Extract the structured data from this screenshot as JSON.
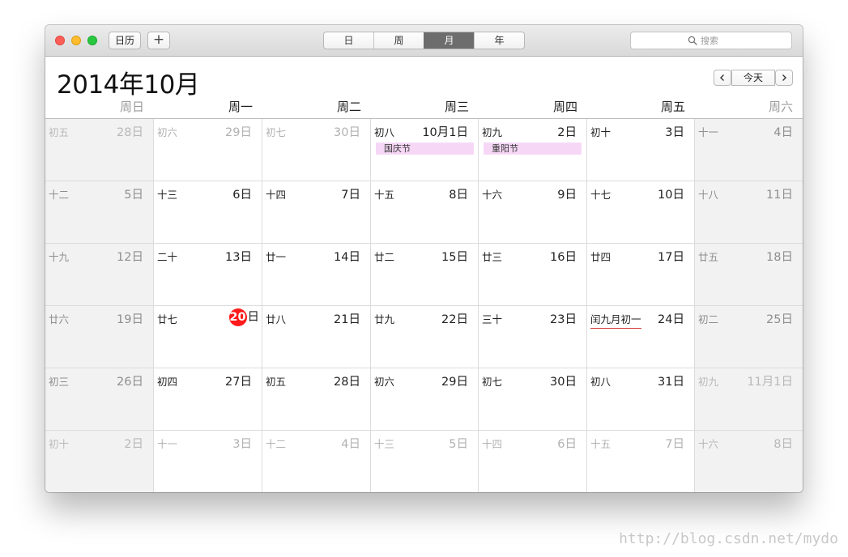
{
  "toolbar": {
    "calendars_label": "日历",
    "add_label": "+",
    "views": [
      "日",
      "周",
      "月",
      "年"
    ],
    "selected_view": "月",
    "search_placeholder": "搜索"
  },
  "header": {
    "title": "2014年10月",
    "today_label": "今天"
  },
  "weekdays": [
    "周日",
    "周一",
    "周二",
    "周三",
    "周四",
    "周五",
    "周六"
  ],
  "weeks": [
    [
      {
        "lunar": "初五",
        "day": "28日",
        "dim": true
      },
      {
        "lunar": "初六",
        "day": "29日",
        "dim": true
      },
      {
        "lunar": "初七",
        "day": "30日",
        "dim": true
      },
      {
        "lunar": "初八",
        "day": "10月1日",
        "event": "国庆节"
      },
      {
        "lunar": "初九",
        "day": "2日",
        "event": "重阳节"
      },
      {
        "lunar": "初十",
        "day": "3日"
      },
      {
        "lunar": "十一",
        "day": "4日"
      }
    ],
    [
      {
        "lunar": "十二",
        "day": "5日"
      },
      {
        "lunar": "十三",
        "day": "6日"
      },
      {
        "lunar": "十四",
        "day": "7日"
      },
      {
        "lunar": "十五",
        "day": "8日"
      },
      {
        "lunar": "十六",
        "day": "9日"
      },
      {
        "lunar": "十七",
        "day": "10日"
      },
      {
        "lunar": "十八",
        "day": "11日"
      }
    ],
    [
      {
        "lunar": "十九",
        "day": "12日"
      },
      {
        "lunar": "二十",
        "day": "13日"
      },
      {
        "lunar": "廿一",
        "day": "14日"
      },
      {
        "lunar": "廿二",
        "day": "15日"
      },
      {
        "lunar": "廿三",
        "day": "16日"
      },
      {
        "lunar": "廿四",
        "day": "17日"
      },
      {
        "lunar": "廿五",
        "day": "18日"
      }
    ],
    [
      {
        "lunar": "廿六",
        "day": "19日"
      },
      {
        "lunar": "廿七",
        "day_num": "20",
        "day_suffix": "日",
        "today": true
      },
      {
        "lunar": "廿八",
        "day": "21日"
      },
      {
        "lunar": "廿九",
        "day": "22日"
      },
      {
        "lunar": "三十",
        "day": "23日"
      },
      {
        "lunar": "闰九月初一",
        "day": "24日",
        "underline": true
      },
      {
        "lunar": "初二",
        "day": "25日"
      }
    ],
    [
      {
        "lunar": "初三",
        "day": "26日"
      },
      {
        "lunar": "初四",
        "day": "27日"
      },
      {
        "lunar": "初五",
        "day": "28日"
      },
      {
        "lunar": "初六",
        "day": "29日"
      },
      {
        "lunar": "初七",
        "day": "30日"
      },
      {
        "lunar": "初八",
        "day": "31日"
      },
      {
        "lunar": "初九",
        "day": "11月1日",
        "dim": true
      }
    ],
    [
      {
        "lunar": "初十",
        "day": "2日",
        "dim": true
      },
      {
        "lunar": "十一",
        "day": "3日",
        "dim": true
      },
      {
        "lunar": "十二",
        "day": "4日",
        "dim": true
      },
      {
        "lunar": "十三",
        "day": "5日",
        "dim": true
      },
      {
        "lunar": "十四",
        "day": "6日",
        "dim": true
      },
      {
        "lunar": "十五",
        "day": "7日",
        "dim": true
      },
      {
        "lunar": "十六",
        "day": "8日",
        "dim": true
      }
    ]
  ],
  "watermark": "http://blog.csdn.net/mydo",
  "colors": {
    "today": "#ff1b1b",
    "event": "#f6d8f6",
    "selected_segment": "#6d6d6d"
  }
}
